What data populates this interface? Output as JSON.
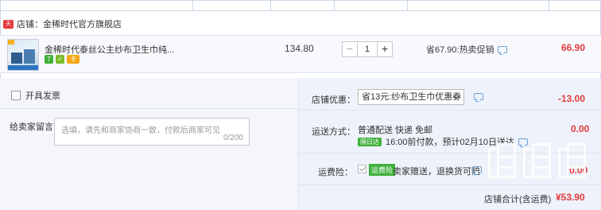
{
  "shop": {
    "icon_text": "天猫",
    "name": "店铺：金稀时代官方旗舰店"
  },
  "item": {
    "title": "金稀时代泰丝公主纱布卫生巾纯...",
    "unit_price": "134.80",
    "quantity": "1",
    "qty_minus": "−",
    "qty_plus": "+",
    "promo": "省67.90:热卖促销",
    "total": "66.90",
    "badges": [
      "7",
      "✓",
      "卡"
    ]
  },
  "left": {
    "invoice_label": "开具发票",
    "message_label": "给卖家留言：",
    "message_placeholder": "选填，请先和商家协商一致，付款后商家可见",
    "message_count": "0/200"
  },
  "right": {
    "coupon_label": "店铺优惠：",
    "coupon_value": "省13元:纱布卫生巾优惠券",
    "coupon_discount": "-13.00",
    "shipping_label": "运送方式：",
    "shipping_line1": "普通配送 快递 免邮",
    "sameday_badge": "隔日达",
    "shipping_line2": "16:00前付款，预计02月10日送达",
    "shipping_fee": "0.00",
    "insurance_label": "运费险：",
    "insurance_badge": "运费险",
    "insurance_text": "卖家赠送，退换货可赔",
    "insurance_fee": "0.00",
    "total_label": "店铺合计(含运费)",
    "total_amount": "¥53.90"
  },
  "colors": {
    "accent_red": "#e4393c",
    "green_badge": "#3fb03b",
    "border_blue": "#cbd6e6"
  }
}
